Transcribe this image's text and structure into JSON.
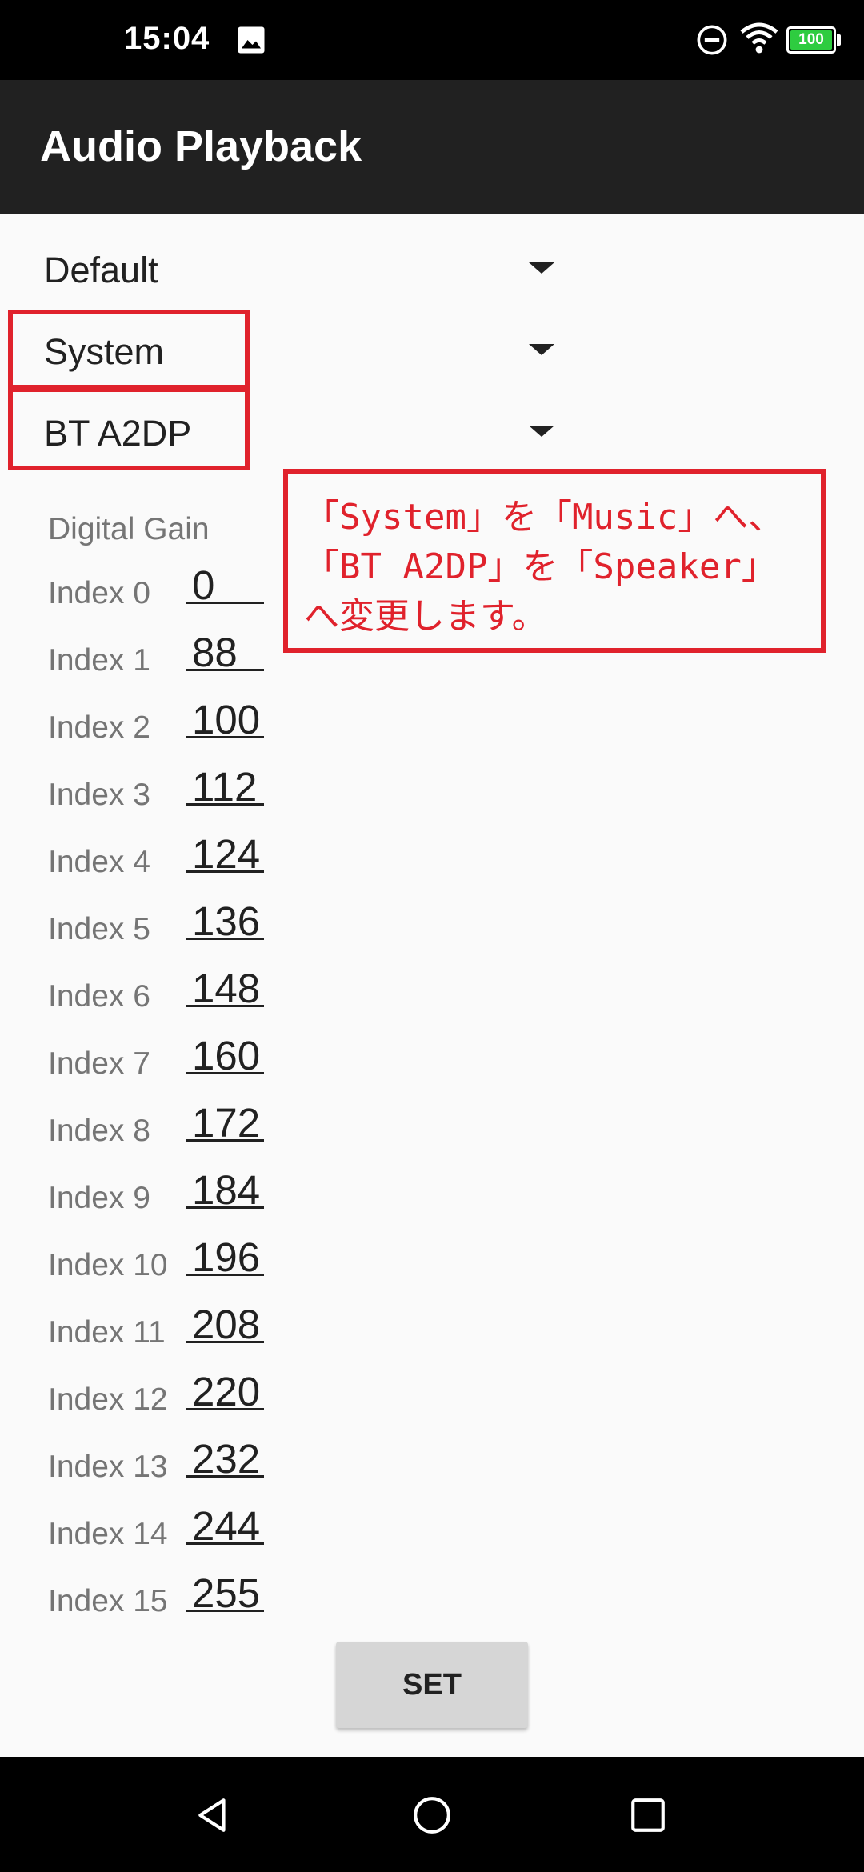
{
  "status_bar": {
    "time": "15:04",
    "battery_level": "100",
    "icons": [
      "image-icon",
      "do-not-disturb-icon",
      "wifi-icon",
      "battery-icon"
    ]
  },
  "toolbar": {
    "title": "Audio Playback"
  },
  "spinners": {
    "mode": "Default",
    "stream": "System",
    "device": "BT A2DP"
  },
  "annotation": {
    "line1": "「System」を「Music」へ、",
    "line2": "「BT A2DP」を「Speaker」",
    "line3": "へ変更します。"
  },
  "digital_gain": {
    "header": "Digital Gain",
    "rows": [
      {
        "label": "Index 0",
        "value": "0"
      },
      {
        "label": "Index 1",
        "value": "88"
      },
      {
        "label": "Index 2",
        "value": "100"
      },
      {
        "label": "Index 3",
        "value": "112"
      },
      {
        "label": "Index 4",
        "value": "124"
      },
      {
        "label": "Index 5",
        "value": "136"
      },
      {
        "label": "Index 6",
        "value": "148"
      },
      {
        "label": "Index 7",
        "value": "160"
      },
      {
        "label": "Index 8",
        "value": "172"
      },
      {
        "label": "Index 9",
        "value": "184"
      },
      {
        "label": "Index 10",
        "value": "196"
      },
      {
        "label": "Index 11",
        "value": "208"
      },
      {
        "label": "Index 12",
        "value": "220"
      },
      {
        "label": "Index 13",
        "value": "232"
      },
      {
        "label": "Index 14",
        "value": "244"
      },
      {
        "label": "Index 15",
        "value": "255"
      }
    ]
  },
  "buttons": {
    "set_label": "SET"
  },
  "colors": {
    "annotation_red": "#e0222c",
    "toolbar": "#212121",
    "battery_green": "#2ecc40"
  }
}
